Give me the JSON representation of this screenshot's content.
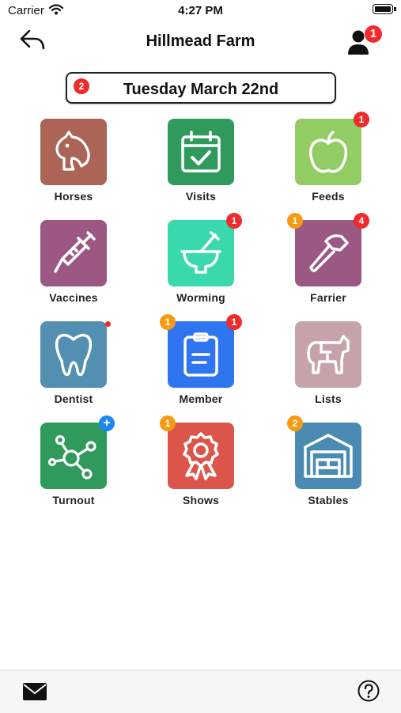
{
  "status_bar": {
    "carrier": "Carrier",
    "time": "4:27 PM"
  },
  "nav": {
    "title": "Hillmead Farm",
    "profile_badge": "1"
  },
  "date_button": {
    "label": "Tuesday March 22nd",
    "badge": "2"
  },
  "colors": {
    "badge_red": "#f02b2b",
    "badge_orange": "#f59a12",
    "badge_blue": "#1c86f2"
  },
  "tiles": [
    {
      "label": "Horses",
      "color": "#ac6457",
      "icon": "horse-head-icon"
    },
    {
      "label": "Visits",
      "color": "#2f9a5c",
      "icon": "calendar-check-icon"
    },
    {
      "label": "Feeds",
      "color": "#92cd63",
      "icon": "apple-icon",
      "badge_right": "1"
    },
    {
      "label": "Vaccines",
      "color": "#9c5883",
      "icon": "syringe-icon"
    },
    {
      "label": "Worming",
      "color": "#39d9ad",
      "icon": "mortar-pestle-icon",
      "badge_right": "1"
    },
    {
      "label": "Farrier",
      "color": "#9a5882",
      "icon": "hammer-icon",
      "badge_left": "1",
      "badge_right": "4"
    },
    {
      "label": "Dentist",
      "color": "#528fb0",
      "icon": "tooth-icon",
      "dot": true
    },
    {
      "label": "Member",
      "color": "#2e75ef",
      "icon": "clipboard-icon",
      "badge_left": "1",
      "badge_right": "1"
    },
    {
      "label": "Lists",
      "color": "#c5a3a8",
      "icon": "pony-icon"
    },
    {
      "label": "Turnout",
      "color": "#2f9a5c",
      "icon": "network-icon",
      "badge_right": "+"
    },
    {
      "label": "Shows",
      "color": "#dc554b",
      "icon": "rosette-icon",
      "badge_left": "1"
    },
    {
      "label": "Stables",
      "color": "#4b8ab2",
      "icon": "barn-icon",
      "badge_left": "2"
    }
  ]
}
